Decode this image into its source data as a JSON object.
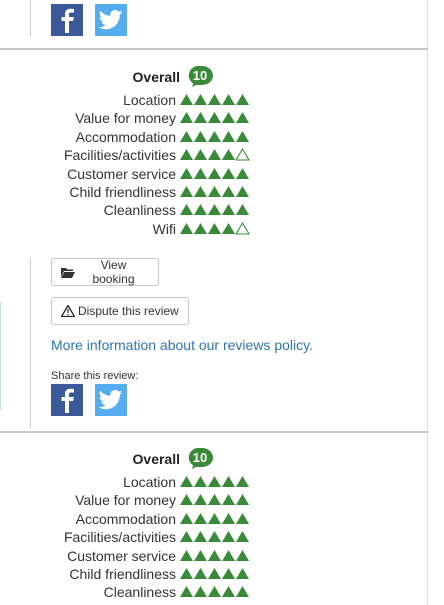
{
  "top_social": {
    "facebook_icon": "facebook-icon",
    "twitter_icon": "twitter-icon"
  },
  "review1": {
    "overall_label": "Overall",
    "overall_score": "10",
    "ratings": [
      {
        "label": "Location",
        "stars": 5
      },
      {
        "label": "Value for money",
        "stars": 5
      },
      {
        "label": "Accommodation",
        "stars": 5
      },
      {
        "label": "Facilities/activities",
        "stars": 4
      },
      {
        "label": "Customer service",
        "stars": 5
      },
      {
        "label": "Child friendliness",
        "stars": 5
      },
      {
        "label": "Cleanliness",
        "stars": 5
      },
      {
        "label": "Wifi",
        "stars": 4
      }
    ],
    "view_booking_label": "View booking",
    "dispute_label": "Dispute this review",
    "policy_link": "More information about our reviews policy.",
    "share_label": "Share this review:"
  },
  "review2": {
    "overall_label": "Overall",
    "overall_score": "10",
    "ratings": [
      {
        "label": "Location",
        "stars": 5
      },
      {
        "label": "Value for money",
        "stars": 5
      },
      {
        "label": "Accommodation",
        "stars": 5
      },
      {
        "label": "Facilities/activities",
        "stars": 5
      },
      {
        "label": "Customer service",
        "stars": 5
      },
      {
        "label": "Child friendliness",
        "stars": 5
      },
      {
        "label": "Cleanliness",
        "stars": 5
      }
    ]
  },
  "colors": {
    "rating_green": "#3a8a3a",
    "link_blue": "#2e74b5",
    "facebook": "#3b5998",
    "twitter": "#55acee"
  },
  "rating_max": 5
}
